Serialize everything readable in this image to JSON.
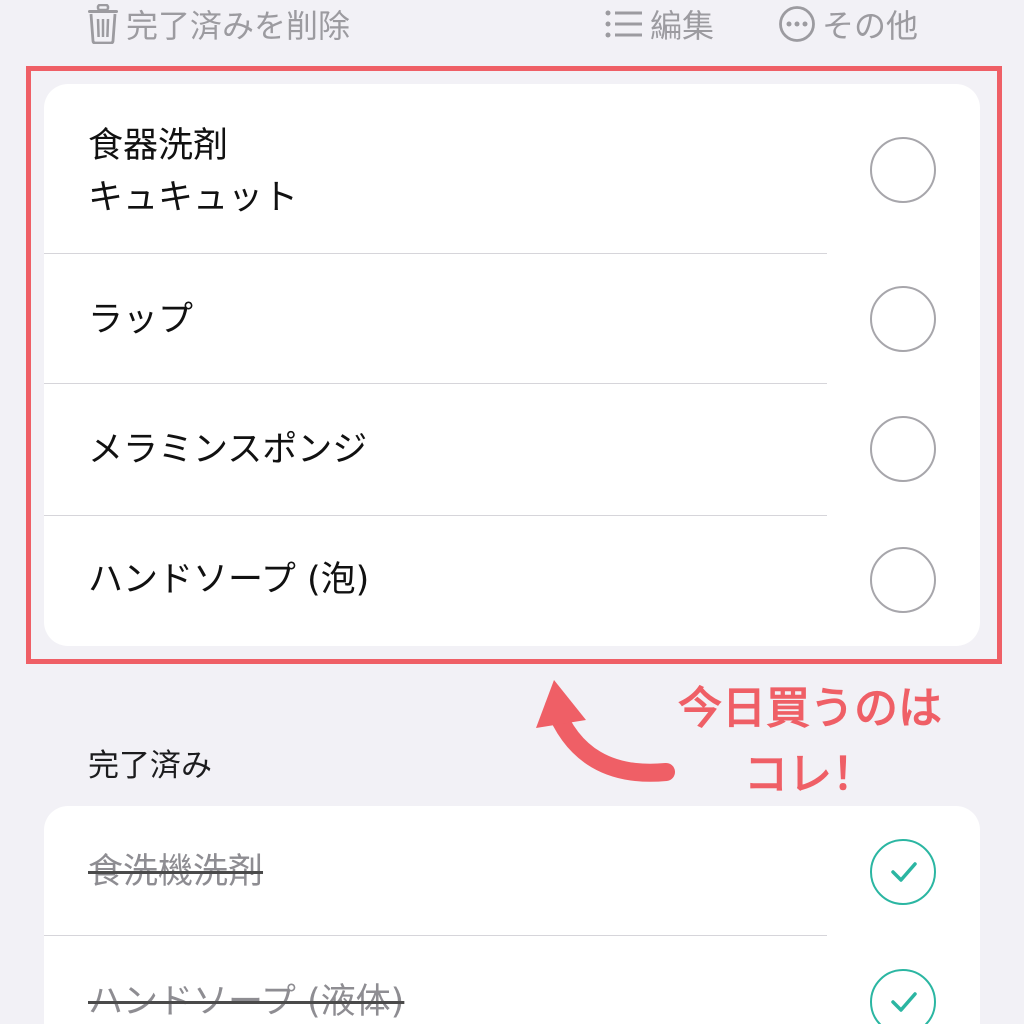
{
  "toolbar": {
    "delete_completed_label": "完了済みを削除",
    "edit_label": "編集",
    "more_label": "その他"
  },
  "active_items": [
    {
      "label_line1": "食器洗剤",
      "label_line2": "キュキュット"
    },
    {
      "label": "ラップ"
    },
    {
      "label": "メラミンスポンジ"
    },
    {
      "label": "ハンドソープ (泡)"
    }
  ],
  "completed_section": {
    "header": "完了済み",
    "items": [
      {
        "label": "食洗機洗剤"
      },
      {
        "label": "ハンドソープ (液体)"
      }
    ]
  },
  "annotation": {
    "line1": "今日買うのは",
    "line2": "コレ！"
  },
  "colors": {
    "background": "#f2f1f6",
    "highlight": "#ef5f66",
    "check_accent": "#2bb6a2",
    "toolbar_text": "#9c9ba0"
  }
}
